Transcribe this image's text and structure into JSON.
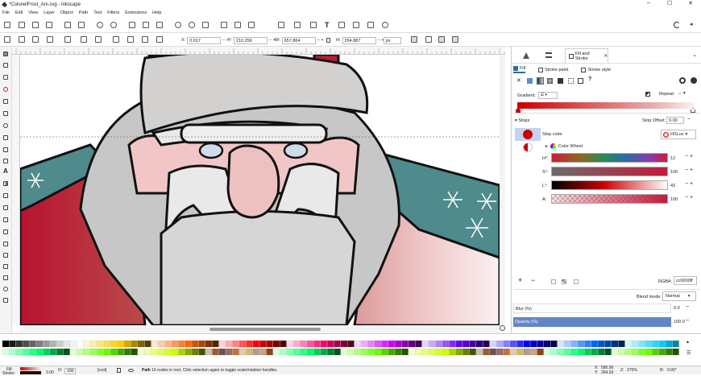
{
  "window": {
    "title": "*ColonelFrost_Am.svg - Inkscape",
    "min": "–",
    "max": "☐",
    "close": "✕"
  },
  "menu": [
    "File",
    "Edit",
    "View",
    "Layer",
    "Object",
    "Path",
    "Text",
    "Filters",
    "Extensions",
    "Help"
  ],
  "toolbar": {
    "x_label": "X:",
    "x_value": "0.017",
    "y_label": "Y:",
    "y_value": "210.256",
    "w_label": "W:",
    "w_value": "657.864",
    "h_label": "H:",
    "h_value": "294.887",
    "unit": "px"
  },
  "dock": {
    "tab_label": "Fill and Stroke",
    "tab_close": "✕",
    "subtabs": {
      "fill": "Fill",
      "stroke_paint": "Stroke paint",
      "stroke_style": "Stroke style"
    },
    "gradient_label": "Gradient:",
    "repeat_label": "Repeat:",
    "stops_label": "Stops",
    "stop_offset_label": "Stop Offset:",
    "stop_offset_value": "0.00",
    "stop_color_label": "Stop color",
    "color_mode": "HSLuv",
    "color_wheel_label": "Color Wheel",
    "channels": [
      {
        "label": "H°:",
        "value": "12"
      },
      {
        "label": "S°:",
        "value": "100"
      },
      {
        "label": "L°:",
        "value": "43"
      },
      {
        "label": "A:",
        "value": "100"
      }
    ],
    "rgba_label": "RGBA:",
    "rgba_value": "cc0000ff",
    "blend_label": "Blend mode:",
    "blend_value": "Normal",
    "blur_label": "Blur (%)",
    "blur_value": "0.0",
    "opacity_label": "Opacity (%)",
    "opacity_value": "100.0",
    "plus": "+",
    "minus": "−",
    "accent": "#cc0000"
  },
  "status": {
    "fill_label": "Fill:",
    "stroke_label": "Stroke:",
    "stroke_width": "3.00",
    "opacity_label": "O:",
    "opacity_value": "100",
    "layer": "[root]",
    "message_bold": "Path",
    "message": " 16 nodes in root. Click selection again to toggle scale/rotation handles.",
    "cursor_x_label": "X:",
    "cursor_x": "580.96",
    "cursor_y_label": "Y:",
    "cursor_y": "264.93",
    "zoom_label": "Z:",
    "zoom": "275%",
    "rotate_label": "R:",
    "rotate": "0.00°"
  },
  "palette": {
    "row1": [
      "#000000",
      "#1a1a1a",
      "#333333",
      "#4d4d4d",
      "#666666",
      "#808080",
      "#999999",
      "#b3b3b3",
      "#cccccc",
      "#e6e6e6",
      "#f2f2f2",
      "#ffffff",
      "#fff6d5",
      "#ffeeaa",
      "#ffe680",
      "#ffdd55",
      "#ffd42a",
      "#ffcc00",
      "#d4aa00",
      "#aa8800",
      "#806600",
      "#554400",
      "#ffe6d5",
      "#ffccaa",
      "#ffb380",
      "#ff9955",
      "#ff7f2a",
      "#ff6600",
      "#d45500",
      "#aa4400",
      "#803300",
      "#552200",
      "#ffd5d5",
      "#ffaaaa",
      "#ff8080",
      "#ff5555",
      "#ff2a2a",
      "#ff0000",
      "#d40000",
      "#aa0000",
      "#800000",
      "#550000",
      "#ffd5e5",
      "#ffaacc",
      "#ff80b2",
      "#ff5599",
      "#ff2a7f",
      "#ff0066",
      "#d40055",
      "#aa0044",
      "#800033",
      "#550022",
      "#f6d5ff",
      "#eeaaff",
      "#e580ff",
      "#dd55ff",
      "#d42aff",
      "#cc00ff",
      "#aa00d4",
      "#8800aa",
      "#660080",
      "#440055",
      "#e5d5ff",
      "#ccaaff",
      "#b380ff",
      "#9955ff",
      "#7f2aff",
      "#6600ff",
      "#5500d4",
      "#4400aa",
      "#330080",
      "#220055",
      "#d5d5ff",
      "#aaaaff",
      "#8080ff",
      "#5555ff",
      "#2a2aff",
      "#0000ff",
      "#0000d4",
      "#0000aa",
      "#000080",
      "#000055",
      "#d5e5ff",
      "#aaccff",
      "#80b3ff",
      "#5599ff",
      "#2a7fff",
      "#0066ff",
      "#0055d4",
      "#0044aa",
      "#003380",
      "#002255",
      "#d5f6ff",
      "#aaeeff",
      "#80e5ff",
      "#55ddff",
      "#2ad4ff",
      "#00ccff",
      "#00aad4",
      "#0088aa",
      "#006680",
      "#004455"
    ],
    "row2": [
      "#d5ffe6",
      "#aaffcc",
      "#80ffb3",
      "#55ff99",
      "#2aff80",
      "#00ff66",
      "#00d455",
      "#00aa44",
      "#008033",
      "#005522",
      "#e5ffd5",
      "#ccffaa",
      "#b3ff80",
      "#99ff55",
      "#7fff2a",
      "#66ff00",
      "#55d400",
      "#44aa00",
      "#338000",
      "#225500",
      "#f6ffd5",
      "#eeffaa",
      "#e5ff80",
      "#ddff55",
      "#d4ff2a",
      "#ccff00",
      "#aad400",
      "#88aa00",
      "#668000",
      "#445500",
      "#c8beb7",
      "#a05a2c",
      "#6c5353",
      "#916f6f",
      "#c87137",
      "#e9c6af",
      "#d3bc5f",
      "#ac9d93",
      "#c4a484",
      "#8b4513"
    ]
  }
}
